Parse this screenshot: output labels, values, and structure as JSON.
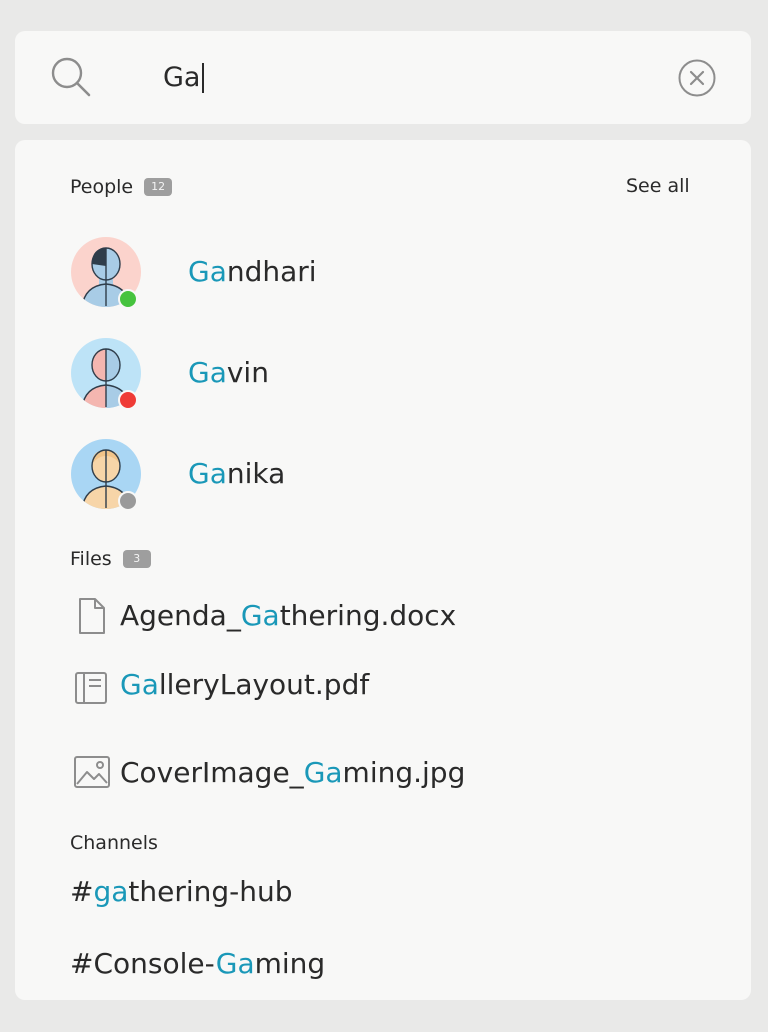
{
  "search": {
    "query": "Ga"
  },
  "people": {
    "label": "People",
    "count": "12",
    "see_all": "See all",
    "items": [
      {
        "match": "Ga",
        "rest": "ndhari",
        "status": "online",
        "status_color": "#46c33e",
        "bg": "#fbd3cc"
      },
      {
        "match": "Ga",
        "rest": "vin",
        "status": "busy",
        "status_color": "#ef3b36",
        "bg": "#bde3f7"
      },
      {
        "match": "Ga",
        "rest": "nika",
        "status": "offline",
        "status_color": "#9a9a9a",
        "bg": "#a9d6f4"
      }
    ]
  },
  "files": {
    "label": "Files",
    "count": "3",
    "items": [
      {
        "icon": "document-icon",
        "pre": "Agenda_",
        "match": "Ga",
        "post": "thering.docx"
      },
      {
        "icon": "pdf-icon",
        "pre": "",
        "match": "Ga",
        "post": "lleryLayout.pdf"
      },
      {
        "icon": "image-icon",
        "pre": "CoverImage_",
        "match": "Ga",
        "post": "ming.jpg"
      }
    ]
  },
  "channels": {
    "label": "Channels",
    "items": [
      {
        "pre": "#",
        "match": "ga",
        "post": "thering-hub"
      },
      {
        "pre": "#Console-",
        "match": "Ga",
        "post": "ming"
      }
    ]
  },
  "colors": {
    "highlight": "#1a98b8",
    "text": "#2a2a2a",
    "panel": "#f8f8f7",
    "page": "#e9e9e8"
  }
}
